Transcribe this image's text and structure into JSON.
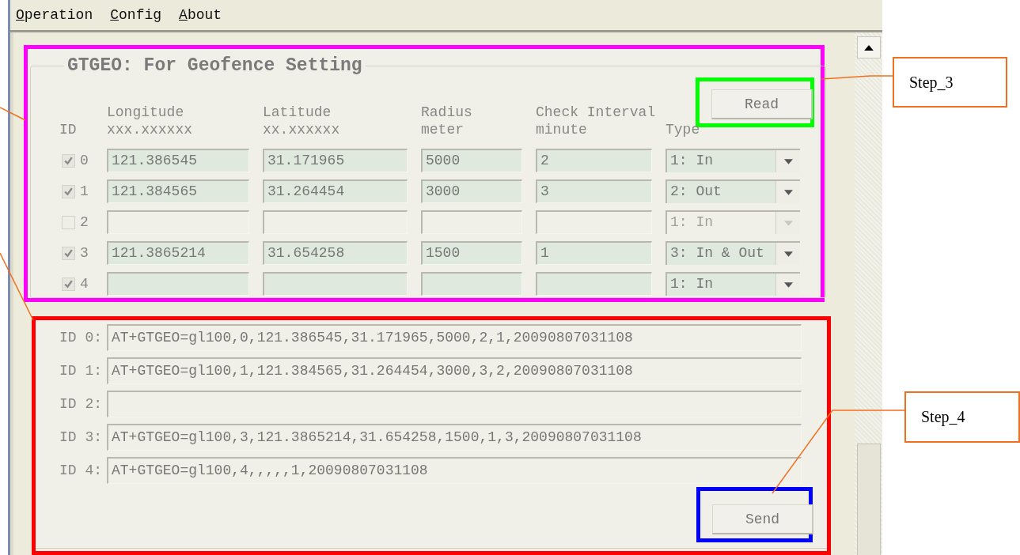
{
  "menu": [
    {
      "label": "Operation"
    },
    {
      "label": "Config"
    },
    {
      "label": "About"
    }
  ],
  "geofence": {
    "title": "GTGEO: For Geofence Setting",
    "read_button": "Read",
    "columns": [
      {
        "label": "ID"
      },
      {
        "label": "Longitude",
        "hint": "xxx.xxxxxx"
      },
      {
        "label": "Latitude",
        "hint": "xx.xxxxxx"
      },
      {
        "label": "Radius",
        "hint": "meter"
      },
      {
        "label": "Check Interval",
        "hint": "minute"
      },
      {
        "label": "Type"
      }
    ],
    "rows": [
      {
        "id": "0",
        "checked": true,
        "longitude": "121.386545",
        "latitude": "31.171965",
        "radius": "5000",
        "interval": "2",
        "type": "1: In"
      },
      {
        "id": "1",
        "checked": true,
        "longitude": "121.384565",
        "latitude": "31.264454",
        "radius": "3000",
        "interval": "3",
        "type": "2: Out"
      },
      {
        "id": "2",
        "checked": false,
        "type": "1: In"
      },
      {
        "id": "3",
        "checked": true,
        "longitude": "121.3865214",
        "latitude": "31.654258",
        "radius": "1500",
        "interval": "1",
        "type": "3: In & Out"
      },
      {
        "id": "4",
        "checked": true,
        "type": "1: In"
      }
    ]
  },
  "commands": {
    "send_button": "Send",
    "rows": [
      {
        "label": "ID 0:",
        "value": "AT+GTGEO=gl100,0,121.386545,31.171965,5000,2,1,20090807031108"
      },
      {
        "label": "ID 1:",
        "value": "AT+GTGEO=gl100,1,121.384565,31.264454,3000,3,2,20090807031108"
      },
      {
        "label": "ID 2:"
      },
      {
        "label": "ID 3:",
        "value": "AT+GTGEO=gl100,3,121.3865214,31.654258,1500,1,3,20090807031108"
      },
      {
        "label": "ID 4:",
        "value": "AT+GTGEO=gl100,4,,,,,1,20090807031108"
      }
    ]
  },
  "highlights": [
    {
      "color": "#ff00ff"
    },
    {
      "color": "#00ff00"
    },
    {
      "color": "#ff0000"
    },
    {
      "color": "#0000ff"
    }
  ],
  "callouts": [
    {
      "label": "Step_3"
    },
    {
      "label": "Step_4"
    }
  ]
}
